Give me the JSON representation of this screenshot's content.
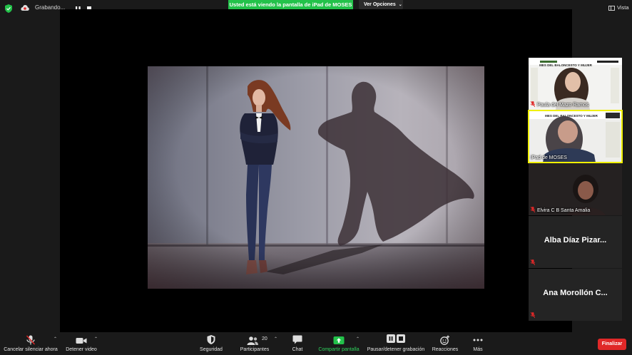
{
  "top_bar": {
    "recording_label": "Grabando...",
    "share_banner": "Usted está viendo la pantalla de iPad de MOSES",
    "view_options": "Ver Opciones",
    "view_label": "Vista"
  },
  "gallery": {
    "participants": [
      {
        "name": "Paula del Mazo Ramos",
        "banner": "MES DEL BALONCESTO Y MUJER",
        "muted": true,
        "video": true
      },
      {
        "name": "iPad de MOSES",
        "banner": "MES DEL BALONCESTO Y MUJER",
        "muted": false,
        "video": true,
        "active_speaker": true
      },
      {
        "name": "Elvira C B Santa Amalia",
        "muted": true,
        "video": true
      },
      {
        "name": "Alba  Díaz Pizar...",
        "muted": true,
        "video": false
      },
      {
        "name": "Ana Morollón C...",
        "muted": true,
        "video": false
      }
    ]
  },
  "toolbar": {
    "mute_label": "Cancelar silenciar ahora",
    "video_label": "Detener video",
    "security_label": "Seguridad",
    "participants_label": "Participantes",
    "participants_count": "20",
    "chat_label": "Chat",
    "share_label": "Compartir pantalla",
    "recording_label": "Pausar/detener grabación",
    "reactions_label": "Reacciones",
    "more_label": "Más",
    "end_label": "Finalizar"
  },
  "colors": {
    "share_green": "#23c24a",
    "end_red": "#e02828",
    "active_speaker": "#f0f000"
  }
}
